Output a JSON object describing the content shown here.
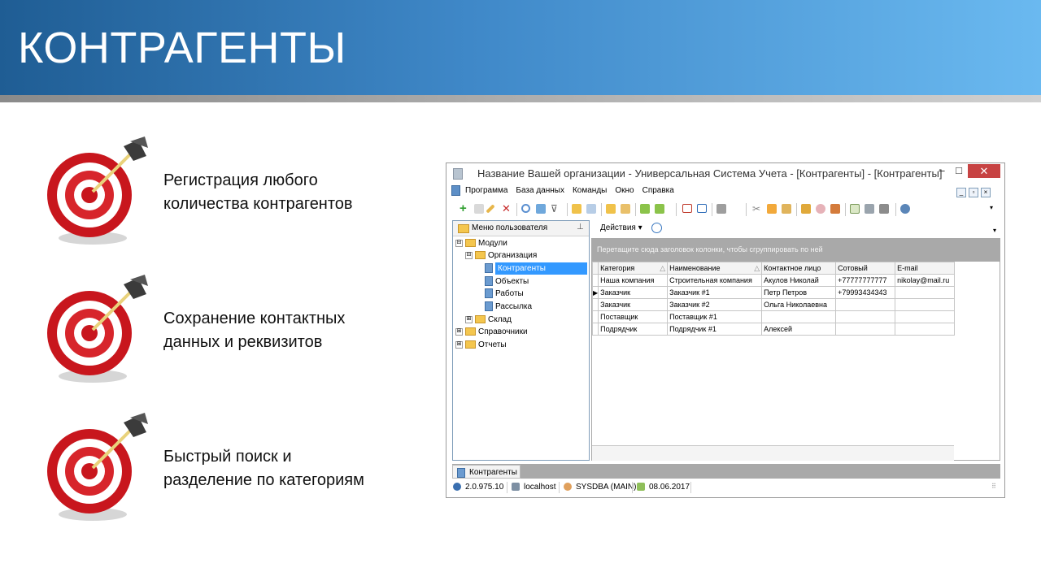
{
  "slide": {
    "title": "КОНТРАГЕНТЫ",
    "features": [
      {
        "line1": "Регистрация любого",
        "line2": "количества контрагентов",
        "icon": "dart-target-icon"
      },
      {
        "line1": "Сохранение контактных",
        "line2": "данных и реквизитов",
        "icon": "dart-target-icon"
      },
      {
        "line1": "Быстрый поиск и",
        "line2": "разделение по категориям",
        "icon": "dart-target-icon"
      }
    ]
  },
  "window": {
    "title": "Название Вашей организации - Универсальная Система Учета - [Контрагенты] - [Контрагенты]",
    "controls": {
      "minimize": "–",
      "maximize": "□",
      "close": "✕"
    },
    "menu": [
      "Программа",
      "База данных",
      "Команды",
      "Окно",
      "Справка"
    ],
    "left_panel": {
      "header": "Меню пользователя",
      "tree": [
        {
          "label": "Модули",
          "level": 0,
          "type": "folder",
          "expander": "⊟"
        },
        {
          "label": "Организация",
          "level": 1,
          "type": "folder",
          "expander": "⊟"
        },
        {
          "label": "Контрагенты",
          "level": 2,
          "type": "doc",
          "selected": true
        },
        {
          "label": "Объекты",
          "level": 2,
          "type": "doc"
        },
        {
          "label": "Работы",
          "level": 2,
          "type": "doc"
        },
        {
          "label": "Рассылка",
          "level": 2,
          "type": "doc"
        },
        {
          "label": "Склад",
          "level": 1,
          "type": "folder",
          "expander": "⊞"
        },
        {
          "label": "Справочники",
          "level": 0,
          "type": "folder",
          "expander": "⊞"
        },
        {
          "label": "Отчеты",
          "level": 0,
          "type": "folder",
          "expander": "⊞"
        }
      ]
    },
    "actions_label": "Действия ▾",
    "group_hint": "Перетащите сюда заголовок колонки, чтобы сгруппировать по ней",
    "grid": {
      "columns": [
        "Категория",
        "Наименование",
        "Контактное лицо",
        "Сотовый",
        "E-mail"
      ],
      "sort_marks": [
        "△",
        "△",
        "",
        "",
        ""
      ],
      "rows": [
        [
          "Наша компания",
          "Строительная компания",
          "Акулов Николай",
          "+77777777777",
          "nikolay@mail.ru"
        ],
        [
          "Заказчик",
          "Заказчик #1",
          "Петр Петров",
          "+79993434343",
          ""
        ],
        [
          "Заказчик",
          "Заказчик #2",
          "Ольга Николаевна",
          "",
          ""
        ],
        [
          "Поставщик",
          "Поставщик #1",
          "",
          "",
          ""
        ],
        [
          "Подрядчик",
          "Подрядчик #1",
          "Алексей",
          "",
          ""
        ]
      ],
      "current_row": 1
    },
    "tab": "Контрагенты",
    "status": {
      "version": "2.0.975.10",
      "host": "localhost",
      "user": "SYSDBA (MAIN)",
      "date": "08.06.2017"
    }
  }
}
